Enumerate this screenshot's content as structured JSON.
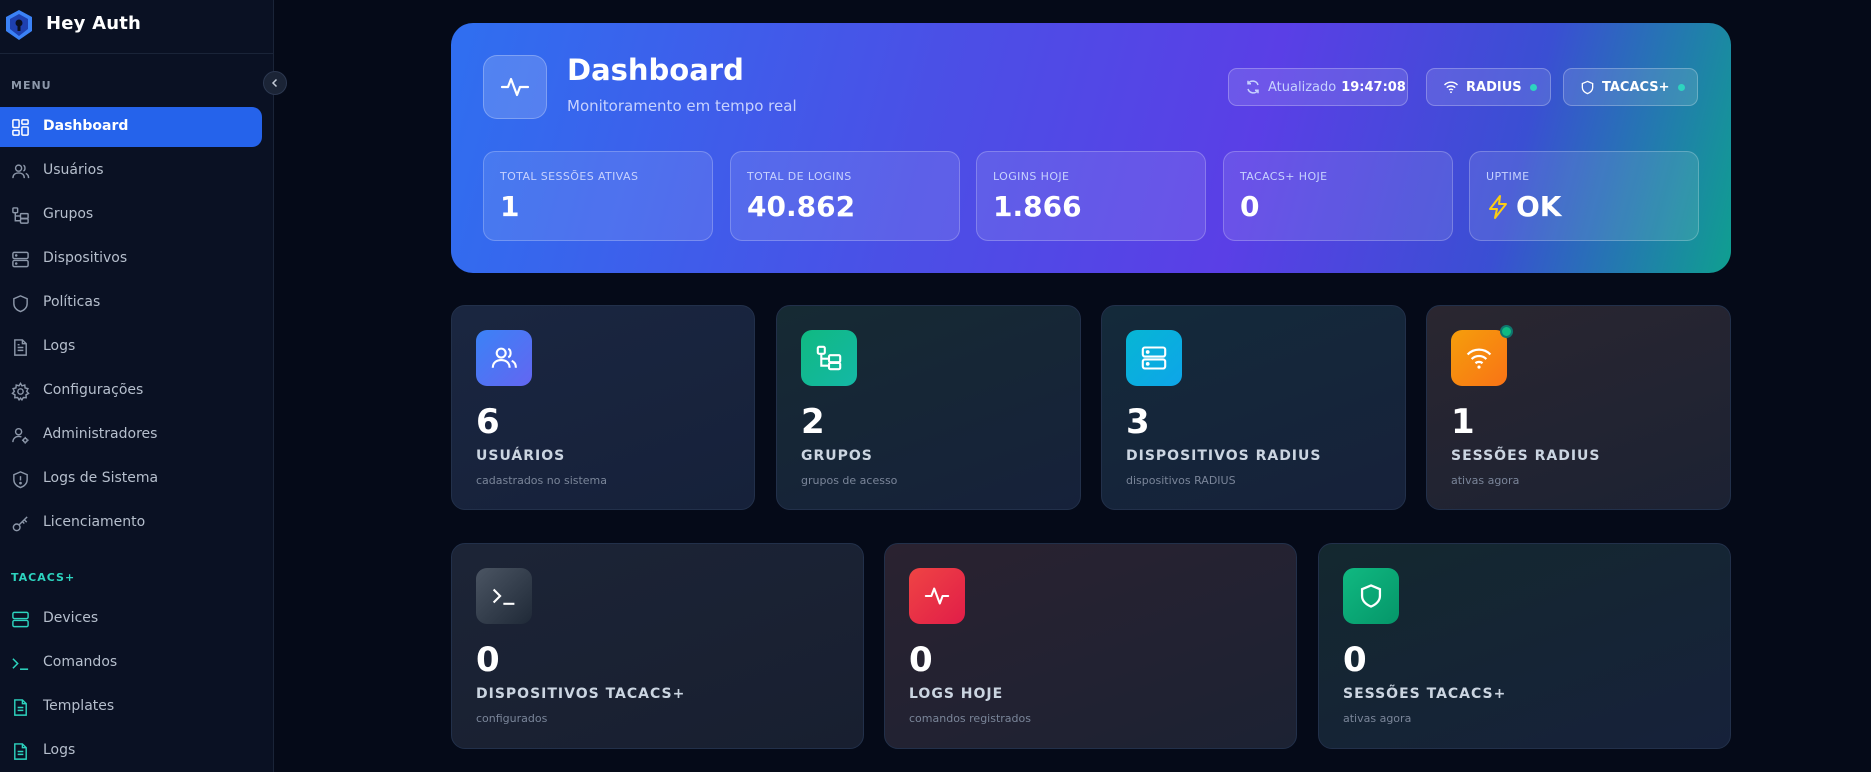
{
  "app": {
    "name": "Hey Auth"
  },
  "sidebar": {
    "menu_label": "MENU",
    "items": [
      {
        "label": "Dashboard",
        "icon": "dashboard-icon",
        "active": true
      },
      {
        "label": "Usuários",
        "icon": "users-icon"
      },
      {
        "label": "Grupos",
        "icon": "groups-icon"
      },
      {
        "label": "Dispositivos",
        "icon": "server-icon"
      },
      {
        "label": "Políticas",
        "icon": "shield-icon"
      },
      {
        "label": "Logs",
        "icon": "file-text-icon"
      },
      {
        "label": "Configurações",
        "icon": "gear-icon"
      },
      {
        "label": "Administradores",
        "icon": "user-gear-icon"
      },
      {
        "label": "Logs de Sistema",
        "icon": "shield-alert-icon"
      },
      {
        "label": "Licenciamento",
        "icon": "key-icon"
      }
    ],
    "tacacs_label": "TACACS+",
    "tacacs_items": [
      {
        "label": "Devices",
        "icon": "server-icon"
      },
      {
        "label": "Comandos",
        "icon": "terminal-icon"
      },
      {
        "label": "Templates",
        "icon": "file-text-icon"
      },
      {
        "label": "Logs",
        "icon": "file-text-icon"
      }
    ]
  },
  "hero": {
    "title": "Dashboard",
    "subtitle": "Monitoramento em tempo real",
    "updated_label": "Atualizado",
    "updated_time": "19:47:08",
    "radius_label": "RADIUS",
    "tacacs_label": "TACACS+",
    "stats": [
      {
        "label": "TOTAL SESSÕES ATIVAS",
        "value": "1"
      },
      {
        "label": "TOTAL DE LOGINS",
        "value": "40.862"
      },
      {
        "label": "LOGINS HOJE",
        "value": "1.866"
      },
      {
        "label": "TACACS+ HOJE",
        "value": "0"
      },
      {
        "label": "UPTIME",
        "value": "OK"
      }
    ]
  },
  "cards_row1": [
    {
      "value": "6",
      "title": "USUÁRIOS",
      "sub": "cadastrados no sistema",
      "icon": "users-icon",
      "color": "#6366f1"
    },
    {
      "value": "2",
      "title": "GRUPOS",
      "sub": "grupos de acesso",
      "icon": "groups-icon",
      "color": "#10b981"
    },
    {
      "value": "3",
      "title": "DISPOSITIVOS RADIUS",
      "sub": "dispositivos RADIUS",
      "icon": "server-icon",
      "color": "#0ea5e9"
    },
    {
      "value": "1",
      "title": "SESSÕES RADIUS",
      "sub": "ativas agora",
      "icon": "wifi-icon",
      "color": "#f97316"
    }
  ],
  "cards_row2": [
    {
      "value": "0",
      "title": "DISPOSITIVOS TACACS+",
      "sub": "configurados",
      "icon": "terminal-icon",
      "color": "#374151"
    },
    {
      "value": "0",
      "title": "LOGS HOJE",
      "sub": "comandos registrados",
      "icon": "activity-icon",
      "color": "#e11d48"
    },
    {
      "value": "0",
      "title": "SESSÕES TACACS+",
      "sub": "ativas agora",
      "icon": "shield-icon",
      "color": "#059669"
    }
  ]
}
